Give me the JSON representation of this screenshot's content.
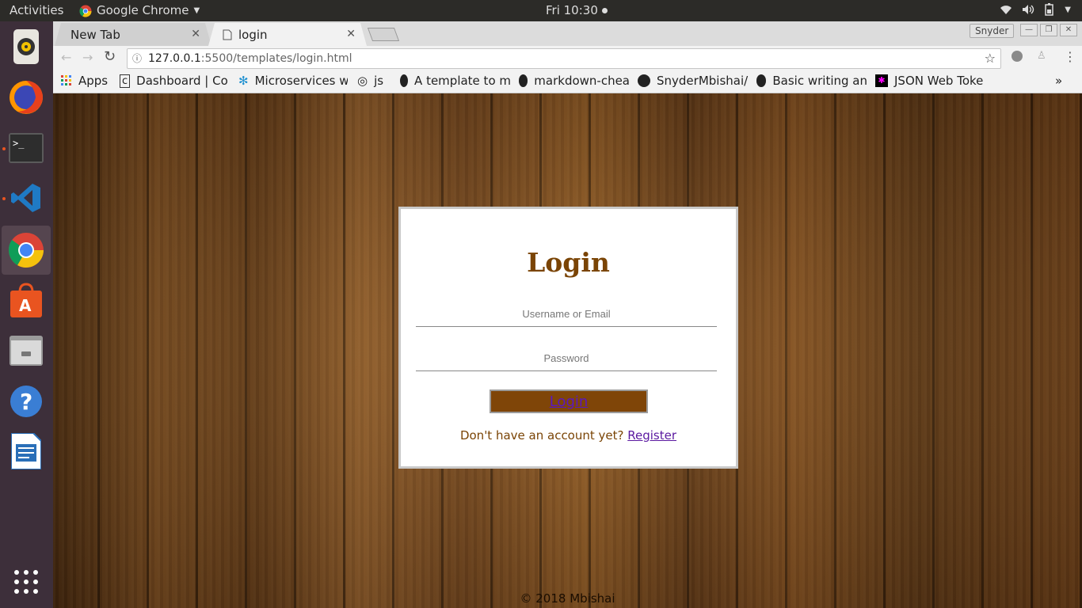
{
  "topbar": {
    "activities": "Activities",
    "app_name": "Google Chrome",
    "clock": "Fri 10:30"
  },
  "dock": {
    "items": [
      "rhythmbox-icon",
      "firefox-icon",
      "terminal-icon",
      "vscode-icon",
      "chrome-icon",
      "software-center-icon",
      "files-icon",
      "help-icon",
      "writer-icon",
      "show-apps-icon"
    ]
  },
  "browser": {
    "tabs": [
      {
        "title": "New Tab"
      },
      {
        "title": "login"
      }
    ],
    "profile": "Snyder",
    "url_host": "127.0.0.1",
    "url_rest": ":5500/templates/login.html",
    "bookmarks": [
      {
        "label": "Apps"
      },
      {
        "label": "Dashboard | Co"
      },
      {
        "label": "Microservices w"
      },
      {
        "label": "js"
      },
      {
        "label": "A template to m"
      },
      {
        "label": "markdown-chea"
      },
      {
        "label": "SnyderMbishai/"
      },
      {
        "label": "Basic writing an"
      },
      {
        "label": "JSON Web Toke"
      }
    ],
    "more_bookmarks": "»"
  },
  "page": {
    "title": "Login",
    "username_placeholder": "Username or Email",
    "password_placeholder": "Password",
    "login_button": "Login",
    "register_prompt": "Don't have an account yet?",
    "register_link": "Register",
    "footer": "© 2018 Mbishai"
  },
  "colors": {
    "accent_brown": "#7a4405",
    "button_bg": "#7f4508",
    "link_purple": "#5a18a0"
  }
}
